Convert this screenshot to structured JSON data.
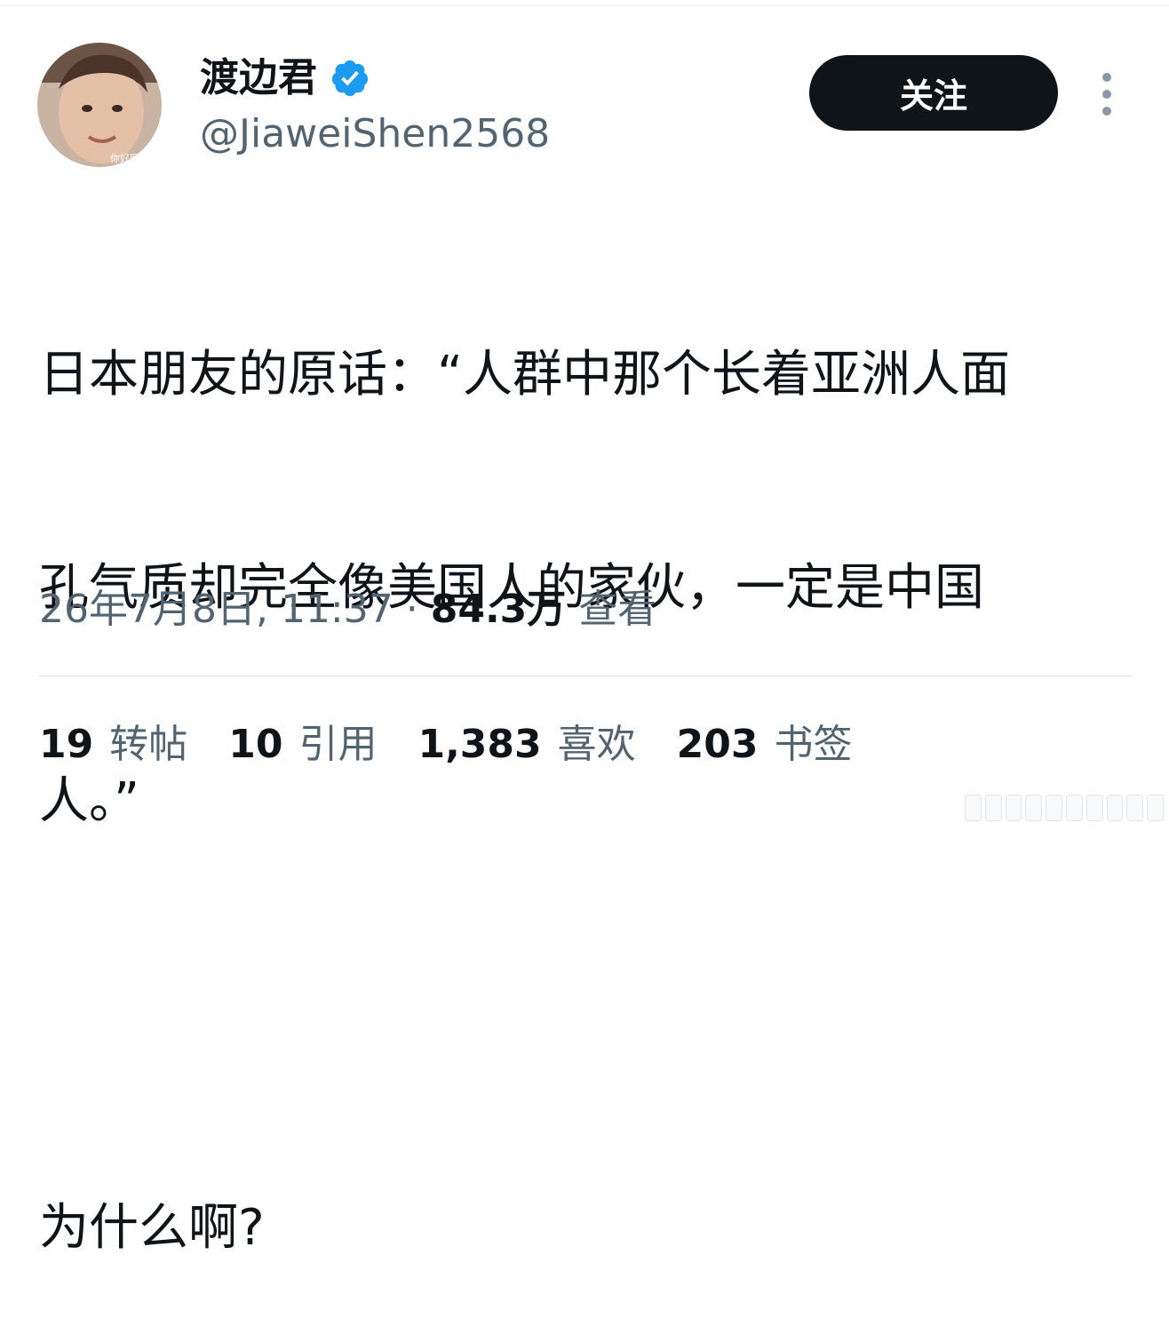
{
  "user": {
    "display_name": "渡边君",
    "handle": "@JiaweiShen2568",
    "verified": true,
    "verified_color": "#1d9bf0",
    "avatar_caption": "你好医院"
  },
  "actions": {
    "follow_label": "关注",
    "more_icon": "more-vertical-icon"
  },
  "tweet": {
    "lines": [
      "日本朋友的原话：“人群中那个长着亚洲人面",
      "孔气质却完全像美国人的家伙，一定是中国",
      "人。”",
      "",
      "为什么啊?"
    ]
  },
  "meta": {
    "timestamp": "26年7月8日, 11:37 · ",
    "views_count": "84.3万",
    "views_label": " 查看"
  },
  "stats": [
    {
      "count": "19",
      "label": "转帖"
    },
    {
      "count": "10",
      "label": "引用"
    },
    {
      "count": "1,383",
      "label": "喜欢"
    },
    {
      "count": "203",
      "label": "书签"
    }
  ],
  "colors": {
    "text_primary": "#0f1419",
    "text_secondary": "#536471",
    "button_bg": "#0f1419",
    "divider": "#dfe4e8"
  }
}
